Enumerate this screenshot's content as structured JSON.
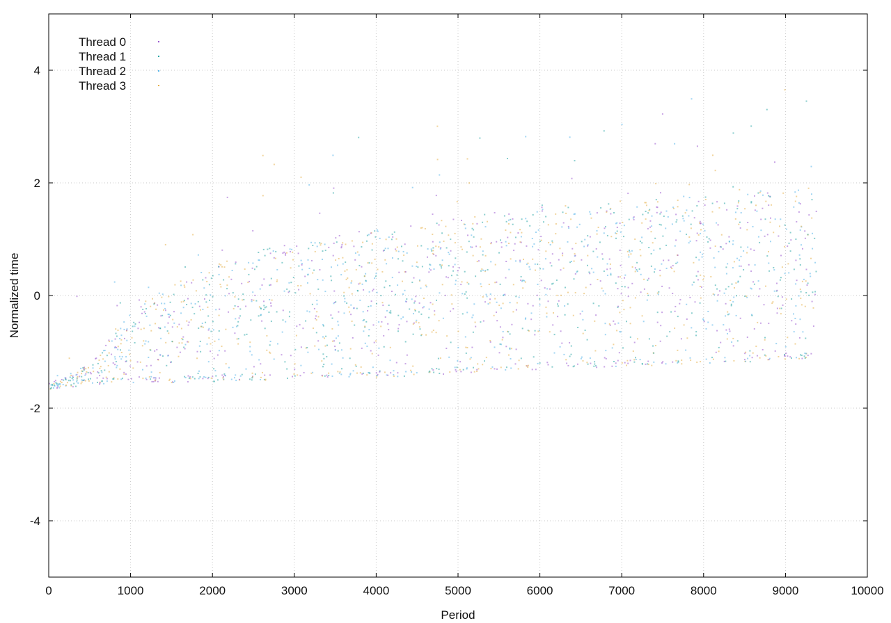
{
  "chart_data": {
    "type": "scatter",
    "xlabel": "Period",
    "ylabel": "Normalized time",
    "xlim": [
      0,
      10000
    ],
    "ylim": [
      -5,
      5
    ],
    "grid": true,
    "x_ticks": [
      0,
      1000,
      2000,
      3000,
      4000,
      5000,
      6000,
      7000,
      8000,
      9000,
      10000
    ],
    "y_ticks": [
      -4,
      -2,
      0,
      2,
      4
    ],
    "legend_position": "top-left",
    "series": [
      {
        "name": "Thread 0",
        "color": "#9b59d0"
      },
      {
        "name": "Thread 1",
        "color": "#2aa6a6"
      },
      {
        "name": "Thread 2",
        "color": "#55b4e9"
      },
      {
        "name": "Thread 3",
        "color": "#e6b04a"
      }
    ],
    "envelope": {
      "period": [
        0,
        500,
        1000,
        2000,
        3000,
        4000,
        5000,
        6000,
        7000,
        8000,
        9000,
        9370
      ],
      "lower": [
        -1.65,
        -1.58,
        -1.55,
        -1.52,
        -1.48,
        -1.45,
        -1.38,
        -1.3,
        -1.25,
        -1.2,
        -1.15,
        -1.1
      ],
      "upper": [
        -1.55,
        -1.2,
        -0.2,
        0.6,
        1.0,
        1.2,
        1.4,
        1.6,
        1.7,
        1.8,
        1.9,
        2.0
      ]
    }
  }
}
